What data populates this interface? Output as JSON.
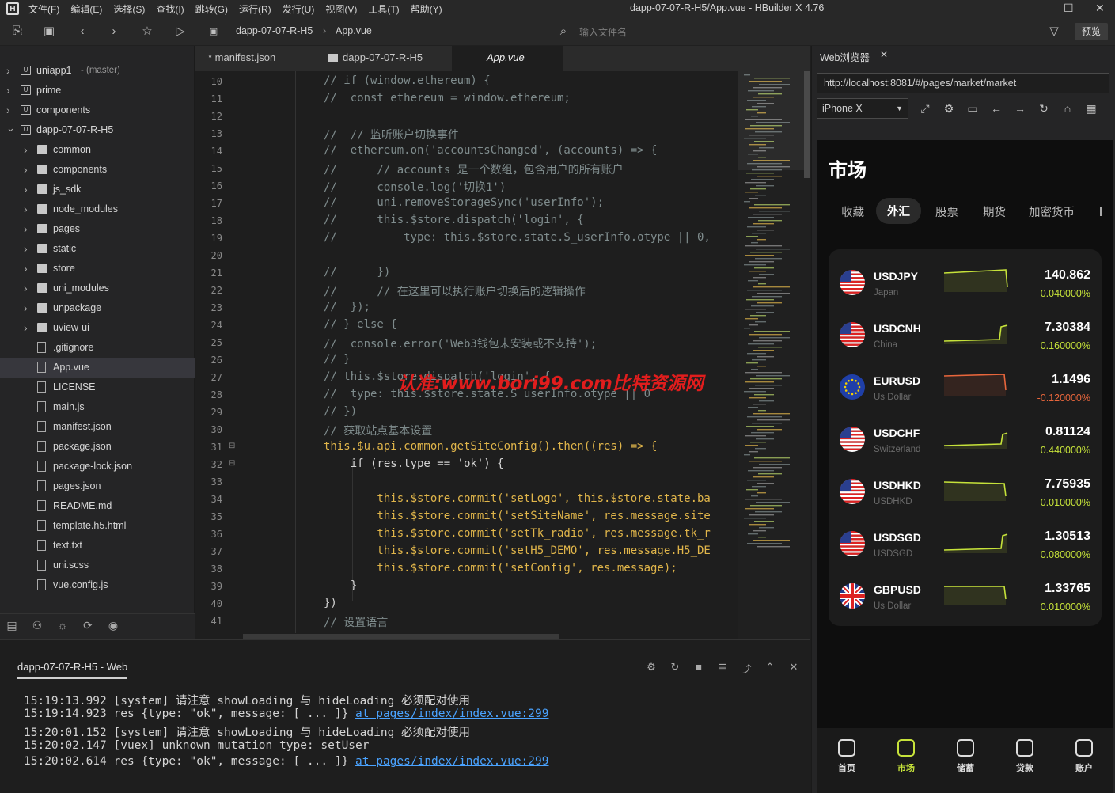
{
  "window": {
    "title": "dapp-07-07-R-H5/App.vue - HBuilder X 4.76",
    "menu": [
      "文件(F)",
      "编辑(E)",
      "选择(S)",
      "查找(I)",
      "跳转(G)",
      "运行(R)",
      "发行(U)",
      "视图(V)",
      "工具(T)",
      "帮助(Y)"
    ]
  },
  "toolbar": {
    "crumb_project": "dapp-07-07-R-H5",
    "crumb_file": "App.vue",
    "search_placeholder": "输入文件名",
    "preview": "预览"
  },
  "explorer": {
    "items": [
      {
        "label": "uniapp1",
        "branch": "- (master)",
        "kind": "project",
        "depth": 0,
        "expanded": false
      },
      {
        "label": "prime",
        "kind": "project",
        "depth": 0,
        "expanded": false
      },
      {
        "label": "components",
        "kind": "project",
        "depth": 0,
        "expanded": false
      },
      {
        "label": "dapp-07-07-R-H5",
        "kind": "project",
        "depth": 0,
        "expanded": true
      },
      {
        "label": "common",
        "kind": "folder",
        "depth": 1
      },
      {
        "label": "components",
        "kind": "folder",
        "depth": 1
      },
      {
        "label": "js_sdk",
        "kind": "folder",
        "depth": 1
      },
      {
        "label": "node_modules",
        "kind": "folder",
        "depth": 1
      },
      {
        "label": "pages",
        "kind": "folder",
        "depth": 1
      },
      {
        "label": "static",
        "kind": "folder",
        "depth": 1
      },
      {
        "label": "store",
        "kind": "folder",
        "depth": 1
      },
      {
        "label": "uni_modules",
        "kind": "folder",
        "depth": 1
      },
      {
        "label": "unpackage",
        "kind": "folder",
        "depth": 1
      },
      {
        "label": "uview-ui",
        "kind": "folder",
        "depth": 1
      },
      {
        "label": ".gitignore",
        "kind": "file",
        "depth": 1
      },
      {
        "label": "App.vue",
        "kind": "file",
        "depth": 1,
        "selected": true
      },
      {
        "label": "LICENSE",
        "kind": "file",
        "depth": 1
      },
      {
        "label": "main.js",
        "kind": "file",
        "depth": 1
      },
      {
        "label": "manifest.json",
        "kind": "file",
        "depth": 1
      },
      {
        "label": "package.json",
        "kind": "file",
        "depth": 1
      },
      {
        "label": "package-lock.json",
        "kind": "file",
        "depth": 1
      },
      {
        "label": "pages.json",
        "kind": "file",
        "depth": 1
      },
      {
        "label": "README.md",
        "kind": "file",
        "depth": 1
      },
      {
        "label": "template.h5.html",
        "kind": "file",
        "depth": 1
      },
      {
        "label": "text.txt",
        "kind": "file",
        "depth": 1
      },
      {
        "label": "uni.scss",
        "kind": "file",
        "depth": 1
      },
      {
        "label": "vue.config.js",
        "kind": "file",
        "depth": 1
      }
    ]
  },
  "tabs": [
    "* manifest.json",
    "dapp-07-07-R-H5",
    "App.vue"
  ],
  "code": {
    "lines": [
      {
        "n": "10",
        "t": "// if (window.ethereum) {",
        "c": "cm",
        "fold": ""
      },
      {
        "n": "11",
        "t": "//  const ethereum = window.ethereum;",
        "c": "cm",
        "fold": ""
      },
      {
        "n": "12",
        "t": "",
        "c": "cm",
        "fold": ""
      },
      {
        "n": "13",
        "t": "//  // 监听账户切换事件",
        "c": "cm",
        "fold": ""
      },
      {
        "n": "14",
        "t": "//  ethereum.on('accountsChanged', (accounts) => {",
        "c": "cm",
        "fold": ""
      },
      {
        "n": "15",
        "t": "//      // accounts 是一个数组，包含用户的所有账户",
        "c": "cm",
        "fold": ""
      },
      {
        "n": "16",
        "t": "//      console.log('切换1')",
        "c": "cm",
        "fold": ""
      },
      {
        "n": "17",
        "t": "//      uni.removeStorageSync('userInfo');",
        "c": "cm",
        "fold": ""
      },
      {
        "n": "18",
        "t": "//      this.$store.dispatch('login', {",
        "c": "cm",
        "fold": ""
      },
      {
        "n": "19",
        "t": "//          type: this.$store.state.S_userInfo.otype || 0,",
        "c": "cm",
        "fold": ""
      },
      {
        "n": "20",
        "t": "",
        "c": "cm",
        "fold": ""
      },
      {
        "n": "21",
        "t": "//      })",
        "c": "cm",
        "fold": ""
      },
      {
        "n": "22",
        "t": "//      // 在这里可以执行账户切换后的逻辑操作",
        "c": "cm",
        "fold": ""
      },
      {
        "n": "23",
        "t": "//  });",
        "c": "cm",
        "fold": ""
      },
      {
        "n": "24",
        "t": "// } else {",
        "c": "cm",
        "fold": ""
      },
      {
        "n": "25",
        "t": "//  console.error('Web3钱包未安装或不支持');",
        "c": "cm",
        "fold": ""
      },
      {
        "n": "26",
        "t": "// }",
        "c": "cm",
        "fold": ""
      },
      {
        "n": "27",
        "t": "// this.$store.dispatch('login', {",
        "c": "cm",
        "fold": ""
      },
      {
        "n": "28",
        "t": "//  type: this.$store.state.S_userInfo.otype || 0",
        "c": "cm",
        "fold": ""
      },
      {
        "n": "29",
        "t": "// })",
        "c": "cm",
        "fold": ""
      },
      {
        "n": "30",
        "t": "// 获取站点基本设置",
        "c": "cm",
        "fold": ""
      },
      {
        "n": "31",
        "t": "this.$u.api.common.getSiteConfig().then((res) => {",
        "c": "code1",
        "fold": "⊟"
      },
      {
        "n": "32",
        "t": "    if (res.type == 'ok') {",
        "c": "code2",
        "fold": "⊟"
      },
      {
        "n": "33",
        "t": "",
        "c": "cm",
        "fold": ""
      },
      {
        "n": "34",
        "t": "        this.$store.commit('setLogo', this.$store.state.ba",
        "c": "commit",
        "fold": ""
      },
      {
        "n": "35",
        "t": "        this.$store.commit('setSiteName', res.message.site",
        "c": "commit",
        "fold": ""
      },
      {
        "n": "36",
        "t": "        this.$store.commit('setTk_radio', res.message.tk_r",
        "c": "commit",
        "fold": ""
      },
      {
        "n": "37",
        "t": "        this.$store.commit('setH5_DEMO', res.message.H5_DE",
        "c": "commit",
        "fold": ""
      },
      {
        "n": "38",
        "t": "        this.$store.commit('setConfig', res.message);",
        "c": "commit",
        "fold": ""
      },
      {
        "n": "39",
        "t": "    }",
        "c": "plain",
        "fold": ""
      },
      {
        "n": "40",
        "t": "})",
        "c": "plain",
        "fold": ""
      },
      {
        "n": "41",
        "t": "// 设置语言",
        "c": "cm",
        "fold": ""
      }
    ]
  },
  "watermark": "认准:www.bori99.com比特资源网",
  "console": {
    "tab": "dapp-07-07-R-H5 - Web",
    "lines": [
      {
        "text": "15:19:13.992 [system] 请注意 showLoading 与 hideLoading 必须配对使用",
        "link": ""
      },
      {
        "text": "15:19:14.923 res {type: \"ok\", message: [ ... ]} ",
        "link": "at pages/index/index.vue:299"
      },
      {
        "text": "15:20:01.152 [system] 请注意 showLoading 与 hideLoading 必须配对使用",
        "link": ""
      },
      {
        "text": "15:20:02.147 [vuex] unknown mutation type: setUser",
        "link": ""
      },
      {
        "text": "15:20:02.614 res {type: \"ok\", message: [ ... ]} ",
        "link": "at pages/index/index.vue:299"
      }
    ]
  },
  "browser": {
    "tab": "Web浏览器",
    "url": "http://localhost:8081/#/pages/market/market",
    "device": "iPhone X"
  },
  "app": {
    "title": "市场",
    "categories": [
      "收藏",
      "外汇",
      "股票",
      "期货",
      "加密货币"
    ],
    "active_category": 1,
    "quotes": [
      {
        "symbol": "USDJPY",
        "sub": "Japan",
        "price": "140.862",
        "change": "0.040000%",
        "dir": "up",
        "flag": "us"
      },
      {
        "symbol": "USDCNH",
        "sub": "China",
        "price": "7.30384",
        "change": "0.160000%",
        "dir": "up",
        "flag": "us"
      },
      {
        "symbol": "EURUSD",
        "sub": "Us Dollar",
        "price": "1.1496",
        "change": "-0.120000%",
        "dir": "down",
        "flag": "eu"
      },
      {
        "symbol": "USDCHF",
        "sub": "Switzerland",
        "price": "0.81124",
        "change": "0.440000%",
        "dir": "up",
        "flag": "us"
      },
      {
        "symbol": "USDHKD",
        "sub": "USDHKD",
        "price": "7.75935",
        "change": "0.010000%",
        "dir": "up",
        "flag": "us"
      },
      {
        "symbol": "USDSGD",
        "sub": "USDSGD",
        "price": "1.30513",
        "change": "0.080000%",
        "dir": "up",
        "flag": "us"
      },
      {
        "symbol": "GBPUSD",
        "sub": "Us Dollar",
        "price": "1.33765",
        "change": "0.010000%",
        "dir": "up",
        "flag": "gb"
      }
    ],
    "nav": [
      "首页",
      "市场",
      "储蓄",
      "贷款",
      "账户"
    ],
    "active_nav": 1,
    "colors": {
      "up": "#c6e23a",
      "down": "#e8663c"
    }
  }
}
